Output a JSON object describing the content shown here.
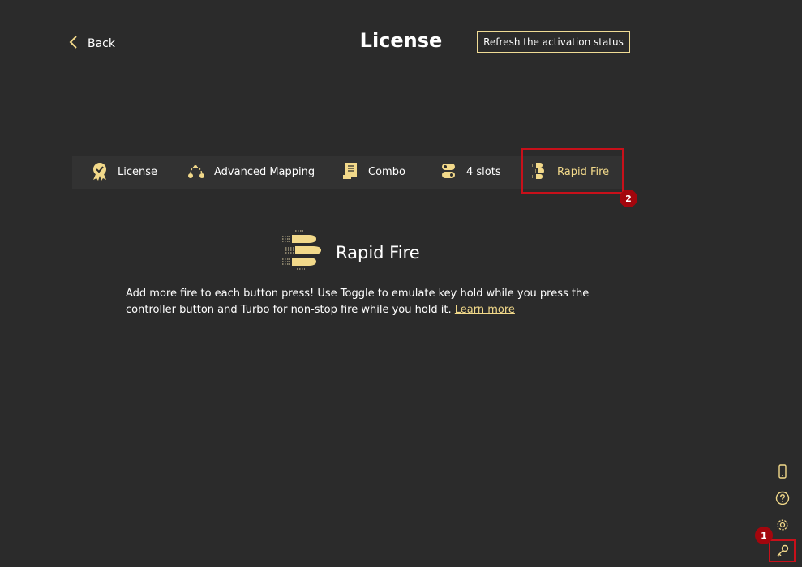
{
  "header": {
    "back_label": "Back",
    "title": "License",
    "refresh_label": "Refresh the activation status"
  },
  "tabs": [
    {
      "label": "License",
      "icon": "award-badge-icon",
      "active": false
    },
    {
      "label": "Advanced Mapping",
      "icon": "mapping-nodes-icon",
      "active": false
    },
    {
      "label": "Combo",
      "icon": "scroll-icon",
      "active": false
    },
    {
      "label": "4 slots",
      "icon": "slots-toggle-icon",
      "active": false
    },
    {
      "label": "Rapid Fire",
      "icon": "bullets-icon",
      "active": true
    }
  ],
  "feature": {
    "title": "Rapid Fire",
    "icon": "bullets-icon",
    "description": "Add more fire to each button press! Use Toggle to emulate key hold while you press the controller button and Turbo for non-stop fire while you hold it.",
    "link_label": "Learn more"
  },
  "sidebar_icons": [
    "phone-icon",
    "help-icon",
    "gear-icon",
    "key-icon"
  ],
  "annotations": {
    "badge_1": "1",
    "badge_2": "2"
  },
  "colors": {
    "background": "#2b2b2b",
    "tab_bar": "#323232",
    "accent": "#f2d98a",
    "highlight": "#c8101a",
    "badge": "#a3060d"
  }
}
